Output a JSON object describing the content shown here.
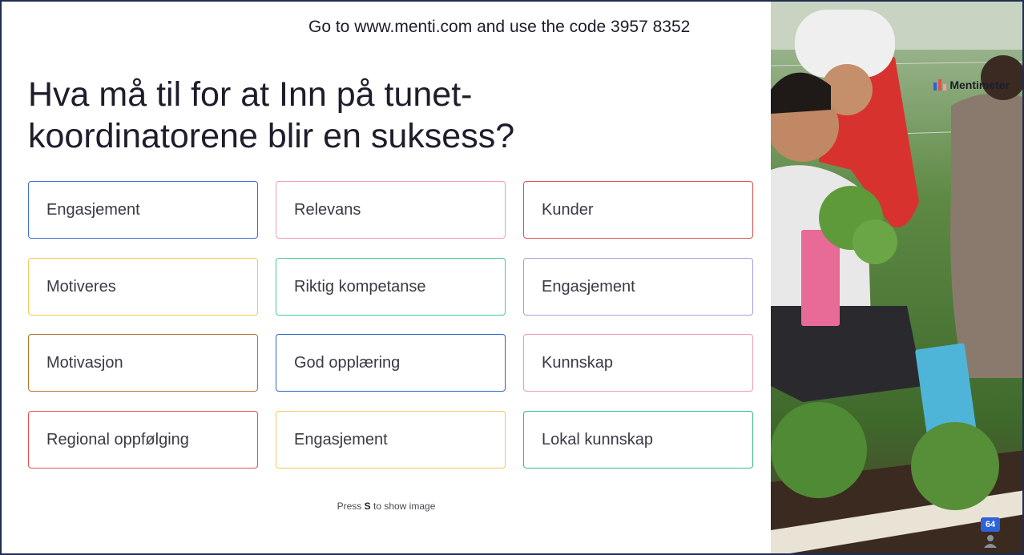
{
  "join": {
    "prefix": "Go to ",
    "url": "www.menti.com",
    "middle": " and use the code ",
    "code": "3957 8352"
  },
  "question": {
    "title": "Hva må til for at Inn på tunet-koordinatorene blir en suksess?"
  },
  "responses": [
    {
      "text": "Engasjement",
      "color": "#3b6fd6"
    },
    {
      "text": "Relevans",
      "color": "#f29ab8"
    },
    {
      "text": "Kunder",
      "color": "#e0504d"
    },
    {
      "text": "Motiveres",
      "color": "#f5c85a"
    },
    {
      "text": "Riktig kompetanse",
      "color": "#47c98a"
    },
    {
      "text": "Engasjement",
      "color": "#a99be8"
    },
    {
      "text": "Motivasjon",
      "color": "#b8742a"
    },
    {
      "text": "God opplæring",
      "color": "#2e62c9"
    },
    {
      "text": "Kunnskap",
      "color": "#f29ab8"
    },
    {
      "text": "Regional oppfølging",
      "color": "#e0504d"
    },
    {
      "text": "Engasjement",
      "color": "#f5c85a"
    },
    {
      "text": "Lokal kunnskap",
      "color": "#2fc08a"
    }
  ],
  "hint": {
    "prefix": "Press ",
    "key": "S",
    "suffix": " to show image"
  },
  "brand": {
    "name": "Mentimeter"
  },
  "participants": {
    "count": "64"
  },
  "icons": {
    "logo": "mentimeter-logo-icon",
    "participants": "person-icon"
  }
}
